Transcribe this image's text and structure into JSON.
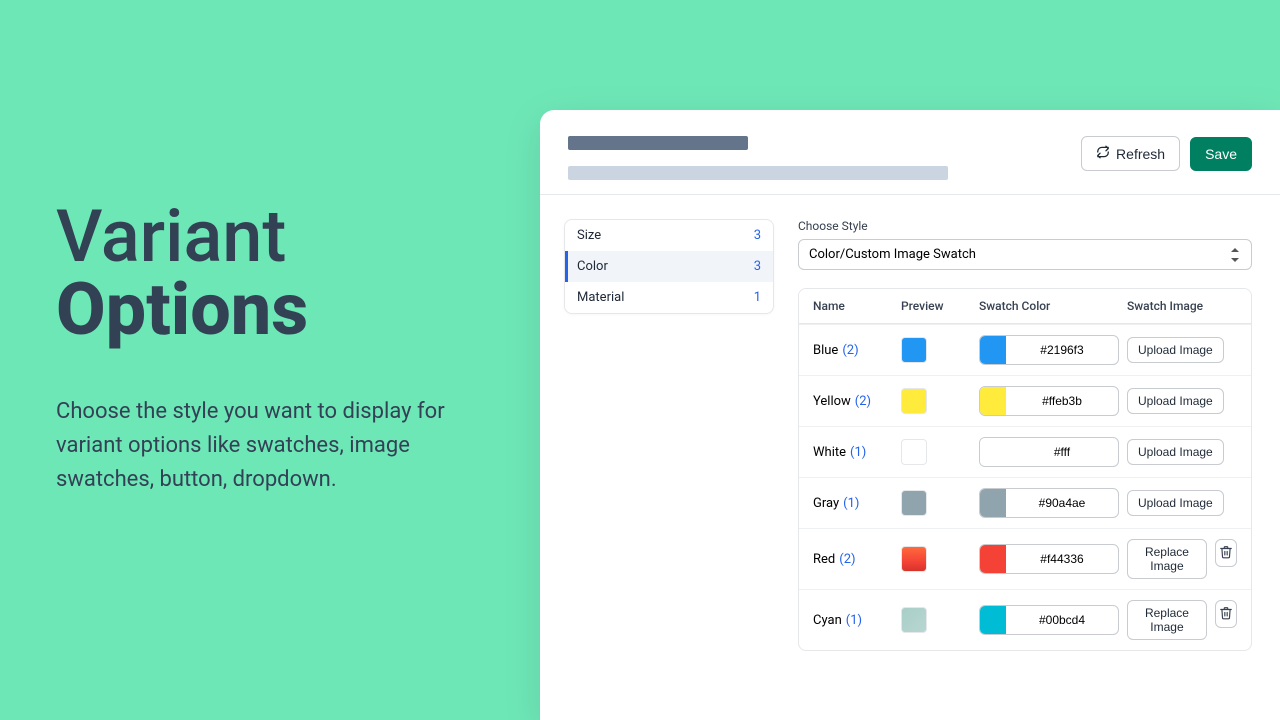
{
  "marketing": {
    "title_line1": "Variant",
    "title_line2": "Options",
    "description": "Choose the style you want to display for variant options like swatches, image swatches, button, dropdown."
  },
  "header": {
    "refresh_label": "Refresh",
    "save_label": "Save"
  },
  "options": [
    {
      "label": "Size",
      "count": "3",
      "active": false
    },
    {
      "label": "Color",
      "count": "3",
      "active": true
    },
    {
      "label": "Material",
      "count": "1",
      "active": false
    }
  ],
  "style": {
    "label": "Choose Style",
    "value": "Color/Custom Image Swatch"
  },
  "table": {
    "head": {
      "name": "Name",
      "preview": "Preview",
      "swatch_color": "Swatch Color",
      "swatch_image": "Swatch Image"
    },
    "upload_label": "Upload Image",
    "replace_label": "Replace Image",
    "rows": [
      {
        "name": "Blue",
        "count": "(2)",
        "hex": "#2196f3",
        "preview": "#2196f3",
        "image": "upload"
      },
      {
        "name": "Yellow",
        "count": "(2)",
        "hex": "#ffeb3b",
        "preview": "#ffeb3b",
        "image": "upload"
      },
      {
        "name": "White",
        "count": "(1)",
        "hex": "#fff",
        "preview": "#ffffff",
        "image": "upload"
      },
      {
        "name": "Gray",
        "count": "(1)",
        "hex": "#90a4ae",
        "preview": "#90a4ae",
        "image": "upload"
      },
      {
        "name": "Red",
        "count": "(2)",
        "hex": "#f44336",
        "preview": "grad-red",
        "image": "replace"
      },
      {
        "name": "Cyan",
        "count": "(1)",
        "hex": "#00bcd4",
        "preview": "grad-cyan",
        "image": "replace"
      }
    ]
  }
}
